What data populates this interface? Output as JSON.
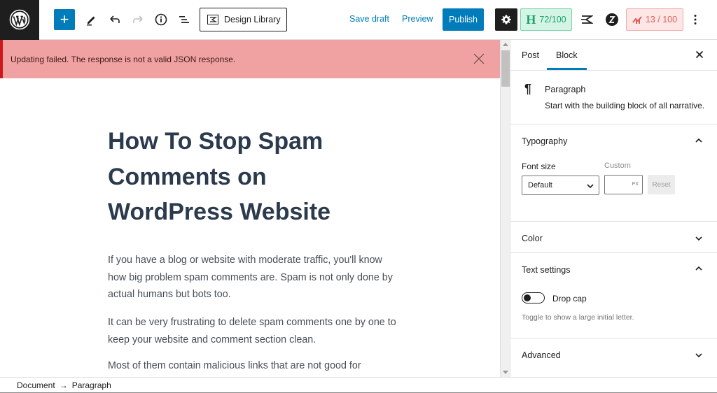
{
  "header": {
    "add_block_label": "+",
    "design_library_label": "Design Library",
    "save_draft_label": "Save draft",
    "preview_label": "Preview",
    "publish_label": "Publish",
    "headline_score": "72/100",
    "headline_letter": "H",
    "seo_score": "13 / 100"
  },
  "notice": {
    "message": "Updating failed. The response is not a valid JSON response."
  },
  "post": {
    "title": "How To Stop Spam Comments on WordPress Website",
    "paragraphs": [
      "If you have a blog or website with moderate traffic, you'll know how big problem spam comments are. Spam is not only done by actual humans but bots too.",
      "It can be very frustrating to delete spam comments one by one to keep your website and comment section clean.",
      "Most of them contain malicious links that are not good for"
    ]
  },
  "sidebar": {
    "tabs": [
      {
        "label": "Post",
        "active": false
      },
      {
        "label": "Block",
        "active": true
      }
    ],
    "block": {
      "icon": "¶",
      "name": "Paragraph",
      "description": "Start with the building block of all narrative."
    },
    "typography": {
      "title": "Typography",
      "font_size_label": "Font size",
      "custom_label": "Custom",
      "font_size_value": "Default",
      "custom_unit": "PX",
      "custom_value": "",
      "reset_label": "Reset"
    },
    "color": {
      "title": "Color"
    },
    "text_settings": {
      "title": "Text settings",
      "drop_cap_label": "Drop cap",
      "drop_cap_enabled": false,
      "drop_cap_help": "Toggle to show a large initial letter."
    },
    "advanced": {
      "title": "Advanced"
    }
  },
  "footer": {
    "breadcrumb": [
      "Document",
      "Paragraph"
    ],
    "separator": "→"
  },
  "colors": {
    "accent": "#007cba",
    "notice_bg": "#f0a1a1",
    "notice_border": "#cc1818",
    "headline_score_bg": "#d4f5e6",
    "seo_score_bg": "#fde6e6"
  }
}
